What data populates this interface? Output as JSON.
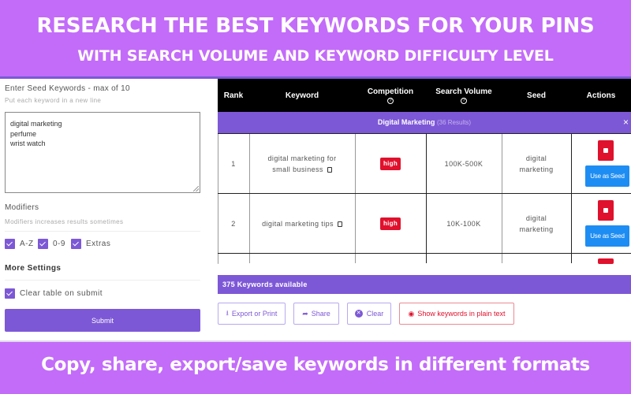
{
  "banner": {
    "title": "RESEARCH THE BEST KEYWORDS FOR YOUR PINS",
    "subtitle": "WITH SEARCH VOLUME AND KEYWORD DIFFICULTY LEVEL",
    "footer": "Copy, share, export/save keywords in different formats"
  },
  "form": {
    "seed_label": "Enter Seed Keywords - max of 10",
    "seed_hint": "Put each keyword in a new line",
    "seed_lines": [
      "digital marketing",
      "perfume",
      "wrist watch"
    ],
    "modifiers_label": "Modifiers",
    "modifiers_hint": "Modifiers increases results sometimes",
    "modifiers": [
      {
        "label": "A-Z",
        "checked": true
      },
      {
        "label": "0-9",
        "checked": true
      },
      {
        "label": "Extras",
        "checked": true
      }
    ],
    "more_settings_label": "More Settings",
    "clear_table": {
      "label": "Clear table on submit",
      "checked": true
    },
    "submit_label": "Submit"
  },
  "table": {
    "headers": {
      "rank": "Rank",
      "keyword": "Keyword",
      "competition": "Competition",
      "search_volume": "Search Volume",
      "seed": "Seed",
      "actions": "Actions"
    },
    "help_icon": "?",
    "group": {
      "name": "Digital Marketing",
      "count_text": "(36 Results)",
      "close": "×"
    },
    "rows": [
      {
        "rank": "1",
        "keyword_line1": "digital marketing for",
        "keyword_line2": "small business",
        "competition": "high",
        "volume": "100K-500K",
        "seed_line1": "digital",
        "seed_line2": "marketing",
        "seed_button": "Use as Seed"
      },
      {
        "rank": "2",
        "keyword_line1": "digital marketing tips",
        "keyword_line2": "",
        "competition": "high",
        "volume": "10K-100K",
        "seed_line1": "digital",
        "seed_line2": "marketing",
        "seed_button": "Use as Seed"
      }
    ],
    "colors": {
      "high": "#e0112c",
      "seed_button": "#1e8df3",
      "accent": "#7d58d6"
    }
  },
  "footer_bar": {
    "available_text": "375 Keywords available",
    "export_label": "Export or Print",
    "share_label": "Share",
    "clear_label": "Clear",
    "plain_text_label": "Show keywords in plain text"
  }
}
